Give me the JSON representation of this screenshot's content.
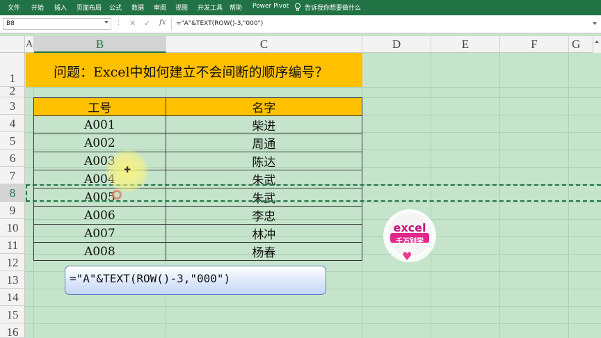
{
  "ribbon": {
    "tabs": [
      "文件",
      "开始",
      "插入",
      "页面布局",
      "公式",
      "数据",
      "审阅",
      "视图",
      "开发工具",
      "帮助",
      "Power Pivot"
    ],
    "tell_me": "告诉我你想要做什么"
  },
  "formula_bar": {
    "name_box": "B8",
    "cancel": "✕",
    "enter": "✓",
    "fx": "fx",
    "formula": "=\"A\"&TEXT(ROW()-3,\"000\")"
  },
  "columns": [
    "A",
    "B",
    "C",
    "D",
    "E",
    "F",
    "G"
  ],
  "rows": [
    "1",
    "2",
    "3",
    "4",
    "5",
    "6",
    "7",
    "8",
    "9",
    "10",
    "11",
    "12",
    "13",
    "14",
    "15",
    "16"
  ],
  "title": "问题：Excel中如何建立不会间断的顺序编号？",
  "table": {
    "headers": [
      "工号",
      "名字"
    ],
    "rows": [
      [
        "A001",
        "柴进"
      ],
      [
        "A002",
        "周通"
      ],
      [
        "A003",
        "陈达"
      ],
      [
        "A004",
        "朱武"
      ],
      [
        "A005",
        "朱武"
      ],
      [
        "A006",
        "李忠"
      ],
      [
        "A007",
        "林冲"
      ],
      [
        "A008",
        "杨春"
      ]
    ]
  },
  "callout": "=\"A\"&TEXT(ROW()-3,\"000\")",
  "logo": {
    "word": "excel",
    "sub": "千万别学"
  },
  "colors": {
    "ribbon": "#217346",
    "sheet": "#c6e4cc",
    "highlight": "#ffc000",
    "logo": "#c8157a"
  }
}
